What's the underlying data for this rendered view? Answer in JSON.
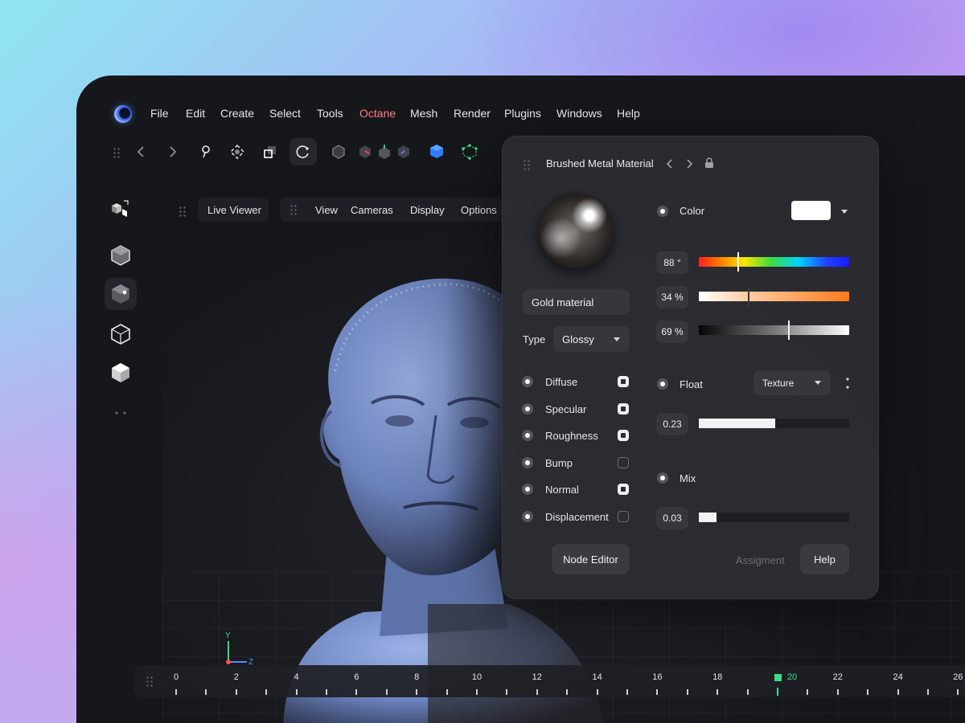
{
  "menu": {
    "items": [
      "File",
      "Edit",
      "Create",
      "Select",
      "Tools",
      "Octane",
      "Mesh",
      "Render",
      "Plugins",
      "Windows",
      "Help"
    ],
    "active": "Octane"
  },
  "toolbar": {
    "icons": [
      "grip-icon",
      "back-arrow-icon",
      "forward-arrow-icon",
      "pin-icon",
      "transform-icon",
      "scale-icon",
      "rotate-icon",
      "cube-outline-icon",
      "cube-red-icon",
      "cube-green-icon",
      "cube-blue-icon",
      "cube-solid-blue-icon",
      "cube-points-icon"
    ]
  },
  "viewport": {
    "tabs": {
      "live_viewer": "Live Viewer",
      "view": "View",
      "cameras": "Cameras",
      "display": "Display",
      "options": "Options"
    },
    "axis": {
      "y": "Y",
      "z": "Z"
    }
  },
  "panel": {
    "title": "Brushed Metal Material",
    "material_name": "Gold material",
    "type_label": "Type",
    "type_value": "Glossy",
    "channels": [
      {
        "label": "Diffuse",
        "checked": true
      },
      {
        "label": "Specular",
        "checked": true
      },
      {
        "label": "Roughness",
        "checked": true
      },
      {
        "label": "Bump",
        "checked": false
      },
      {
        "label": "Normal",
        "checked": true
      },
      {
        "label": "Displacement",
        "checked": false
      }
    ],
    "color_label": "Color",
    "color_swatch": "#ffffff",
    "hue_value": "88 °",
    "hue_fraction": 0.26,
    "saturation_value": "34 %",
    "saturation_fraction": 0.33,
    "brightness_value": "69 %",
    "brightness_fraction": 0.6,
    "float_label": "Float",
    "float_mode": "Texture",
    "float_value": "0.23",
    "float_fraction": 0.51,
    "mix_label": "Mix",
    "mix_value": "0.03",
    "mix_fraction": 0.12,
    "node_editor_label": "Node Editor",
    "assignment_label": "Assigment",
    "help_label": "Help"
  },
  "timeline": {
    "labels": [
      "0",
      "2",
      "4",
      "6",
      "8",
      "10",
      "12",
      "14",
      "16",
      "18",
      "20",
      "22",
      "24",
      "26"
    ],
    "current": "20",
    "accent": "#3ddc84"
  }
}
